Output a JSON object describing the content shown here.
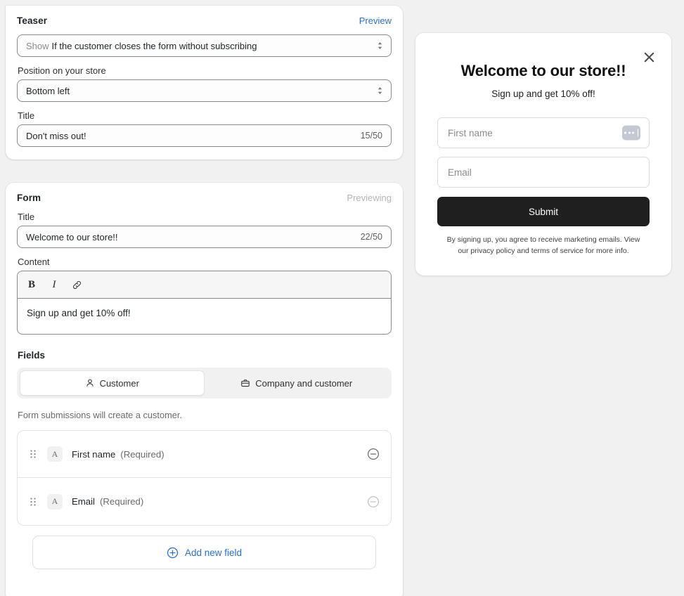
{
  "teaser": {
    "heading": "Teaser",
    "preview_link": "Preview",
    "trigger_prefix": "Show",
    "trigger_value": "If the customer closes the form without subscribing",
    "position_label": "Position on your store",
    "position_value": "Bottom left",
    "title_label": "Title",
    "title_value": "Don't miss out!",
    "title_counter": "15/50"
  },
  "form": {
    "heading": "Form",
    "status": "Previewing",
    "title_label": "Title",
    "title_value": "Welcome to our store!!",
    "title_counter": "22/50",
    "content_label": "Content",
    "toolbar": {
      "bold": "B",
      "italic": "I",
      "link_icon": "link-icon"
    },
    "content_value": "Sign up and get 10% off!",
    "fields_heading": "Fields",
    "tabs": [
      {
        "label": "Customer",
        "icon": "person-icon",
        "active": true
      },
      {
        "label": "Company and customer",
        "icon": "briefcase-icon",
        "active": false
      }
    ],
    "helper_text": "Form submissions will create a customer.",
    "field_rows": [
      {
        "type_icon": "A",
        "name": "First name",
        "required_label": "(Required)",
        "removable": true
      },
      {
        "type_icon": "A",
        "name": "Email",
        "required_label": "(Required)",
        "removable": false
      }
    ],
    "add_field_label": "Add new field"
  },
  "preview_modal": {
    "close_icon": "close-icon",
    "title": "Welcome to our store!!",
    "subtitle": "Sign up and get 10% off!",
    "inputs": [
      {
        "placeholder": "First name",
        "has_badge": true
      },
      {
        "placeholder": "Email",
        "has_badge": false
      }
    ],
    "submit_label": "Submit",
    "legal_text": "By signing up, you agree to receive marketing emails. View our privacy policy and terms of service for more info."
  },
  "colors": {
    "link_blue": "#2c6ecb",
    "page_bg": "#f1f1f1",
    "submit_bg": "#1f1f1f",
    "muted_text": "#6b6b6b"
  }
}
